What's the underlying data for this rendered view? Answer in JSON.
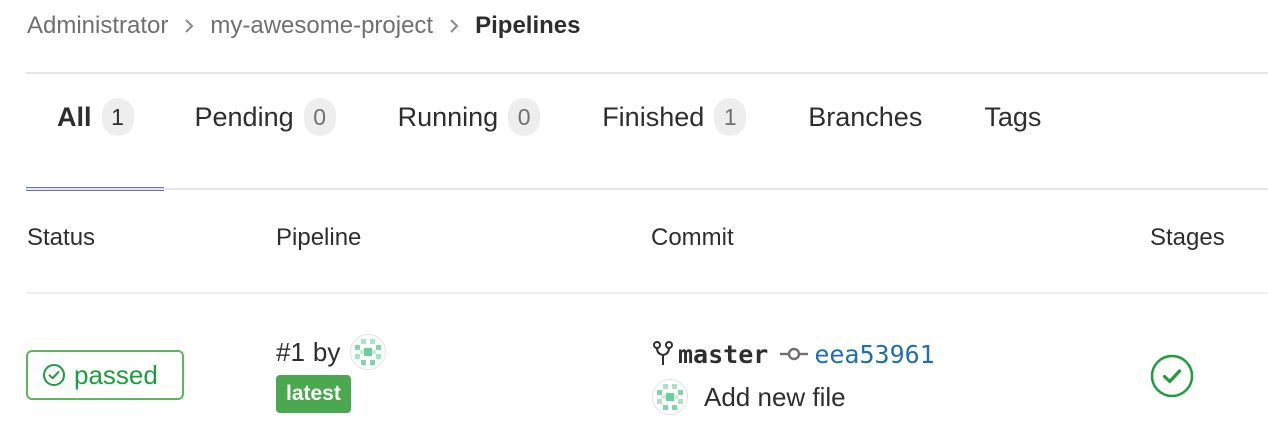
{
  "breadcrumb": {
    "items": [
      "Administrator",
      "my-awesome-project"
    ],
    "current": "Pipelines"
  },
  "tabs": [
    {
      "label": "All",
      "count": "1",
      "active": true
    },
    {
      "label": "Pending",
      "count": "0"
    },
    {
      "label": "Running",
      "count": "0"
    },
    {
      "label": "Finished",
      "count": "1"
    },
    {
      "label": "Branches"
    },
    {
      "label": "Tags"
    }
  ],
  "table": {
    "headers": {
      "status": "Status",
      "pipeline": "Pipeline",
      "commit": "Commit",
      "stages": "Stages"
    },
    "rows": [
      {
        "status": "passed",
        "status_icon": "check-circle-icon",
        "pipeline_id": "#1",
        "pipeline_by": "by",
        "latest_label": "latest",
        "branch_icon": "branch-fork-icon",
        "branch": "master",
        "commit_icon": "commit-icon",
        "sha": "eea53961",
        "commit_title": "Add new file",
        "stage_status_icon": "check-circle-icon"
      }
    ]
  },
  "colors": {
    "accent": "#6b6fc9",
    "success": "#1f9d3f",
    "success_border": "#5db561",
    "latest_bg": "#4aa94e",
    "link": "#1f6fb2"
  }
}
